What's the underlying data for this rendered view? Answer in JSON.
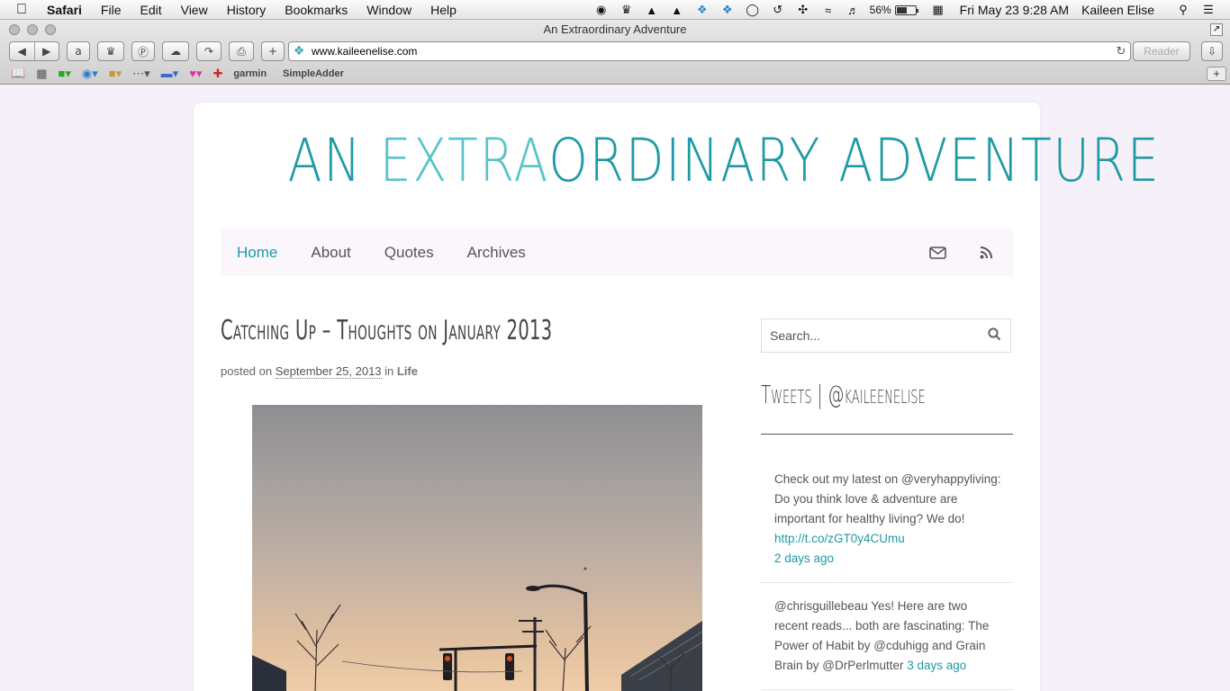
{
  "menubar": {
    "app": "Safari",
    "items": [
      "File",
      "Edit",
      "View",
      "History",
      "Bookmarks",
      "Window",
      "Help"
    ],
    "battery": "56%",
    "battery_level": 0.56,
    "clock": "Fri May 23  9:28 AM",
    "user": "Kaileen Elise"
  },
  "window": {
    "title": "An Extraordinary Adventure",
    "url": "www.kaileenelise.com",
    "reader": "Reader"
  },
  "bookmarks": [
    "garmin",
    "SimpleAdder"
  ],
  "site": {
    "title_part1": "AN ",
    "title_part2": "EXTRA",
    "title_part3": "ORDINARY ADVENTURE",
    "nav": [
      "Home",
      "About",
      "Quotes",
      "Archives"
    ]
  },
  "post": {
    "title": "Catching Up – Thoughts on January 2013",
    "meta_prefix": "posted on ",
    "date": "September 25, 2013",
    "meta_in": " in ",
    "category": "Life"
  },
  "sidebar": {
    "search_placeholder": "Search...",
    "widget_title": "Tweets | @kaileenelise",
    "tweets": [
      {
        "text": "Check out my latest on @veryhappyliving: Do you think love & adventure are important for healthy living? We do! ",
        "link": "http://t.co/zGT0y4CUmu",
        "time": "2 days ago"
      },
      {
        "text": "@chrisguillebeau Yes! Here are two recent reads... both are fascinating: The Power of Habit by @cduhigg and Grain Brain by @DrPerlmutter ",
        "time": "3 days ago"
      }
    ]
  },
  "colors": {
    "accent": "#1f9aa5",
    "accent_light": "#58c3c9",
    "page_bg": "#f6f0f8"
  }
}
